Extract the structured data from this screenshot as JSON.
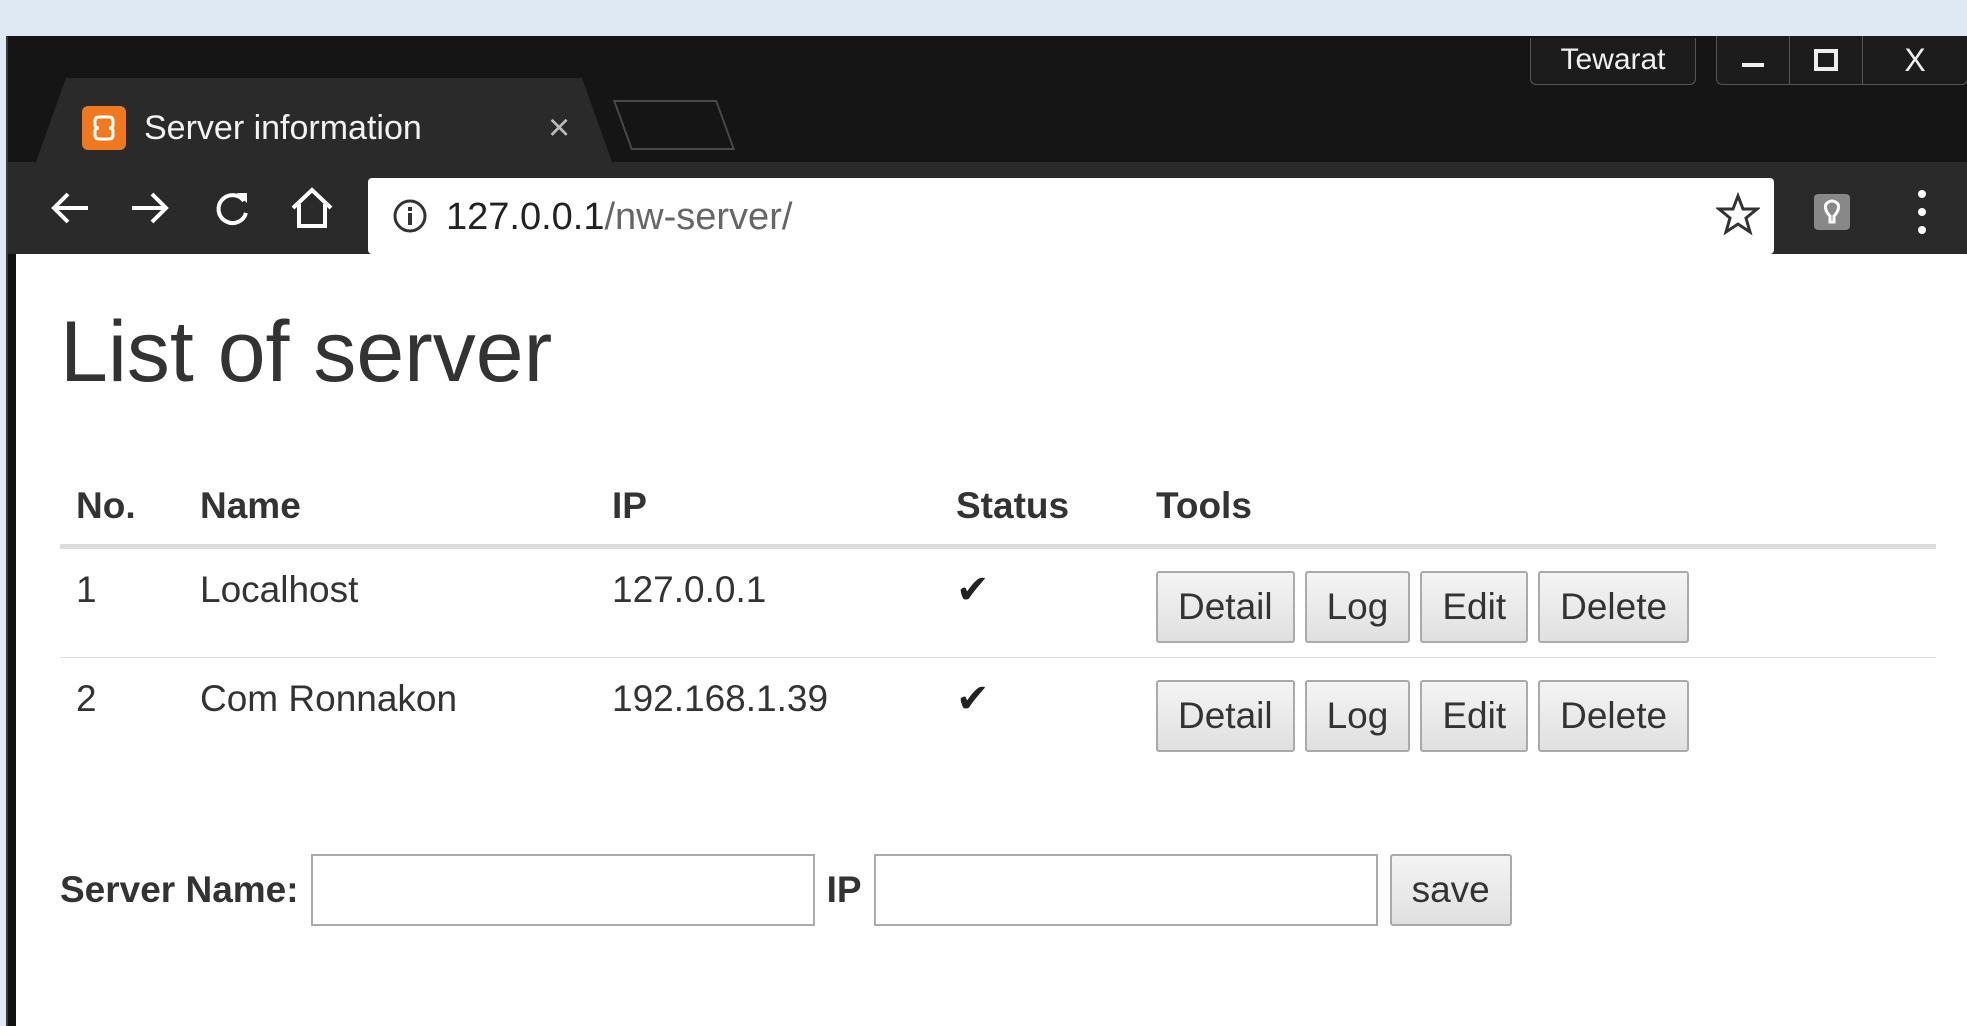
{
  "browser": {
    "profile_name": "Tewarat",
    "window_controls": {
      "close": "X"
    },
    "tab": {
      "title": "Server information",
      "close": "×"
    },
    "address": {
      "host": "127.0.0.1",
      "path": "/nw-server/"
    },
    "icons": [
      "back-arrow-icon",
      "forward-arrow-icon",
      "reload-icon",
      "home-icon",
      "info-icon",
      "star-icon",
      "extension-icon",
      "menu-dots-icon"
    ]
  },
  "page": {
    "title": "List of server",
    "table": {
      "headers": [
        "No.",
        "Name",
        "IP",
        "Status",
        "Tools"
      ],
      "rows": [
        {
          "no": "1",
          "name": "Localhost",
          "ip": "127.0.0.1",
          "status": "✔"
        },
        {
          "no": "2",
          "name": "Com Ronnakon",
          "ip": "192.168.1.39",
          "status": "✔"
        }
      ],
      "tools": [
        "Detail",
        "Log",
        "Edit",
        "Delete"
      ]
    },
    "form": {
      "name_label": "Server Name:",
      "name_value": "",
      "ip_label": "IP",
      "ip_value": "",
      "save_label": "save"
    }
  },
  "colors": {
    "tab_favicon": "#f0781e",
    "chrome_dark": "#2a2a2a",
    "page_bg": "#ffffff"
  }
}
